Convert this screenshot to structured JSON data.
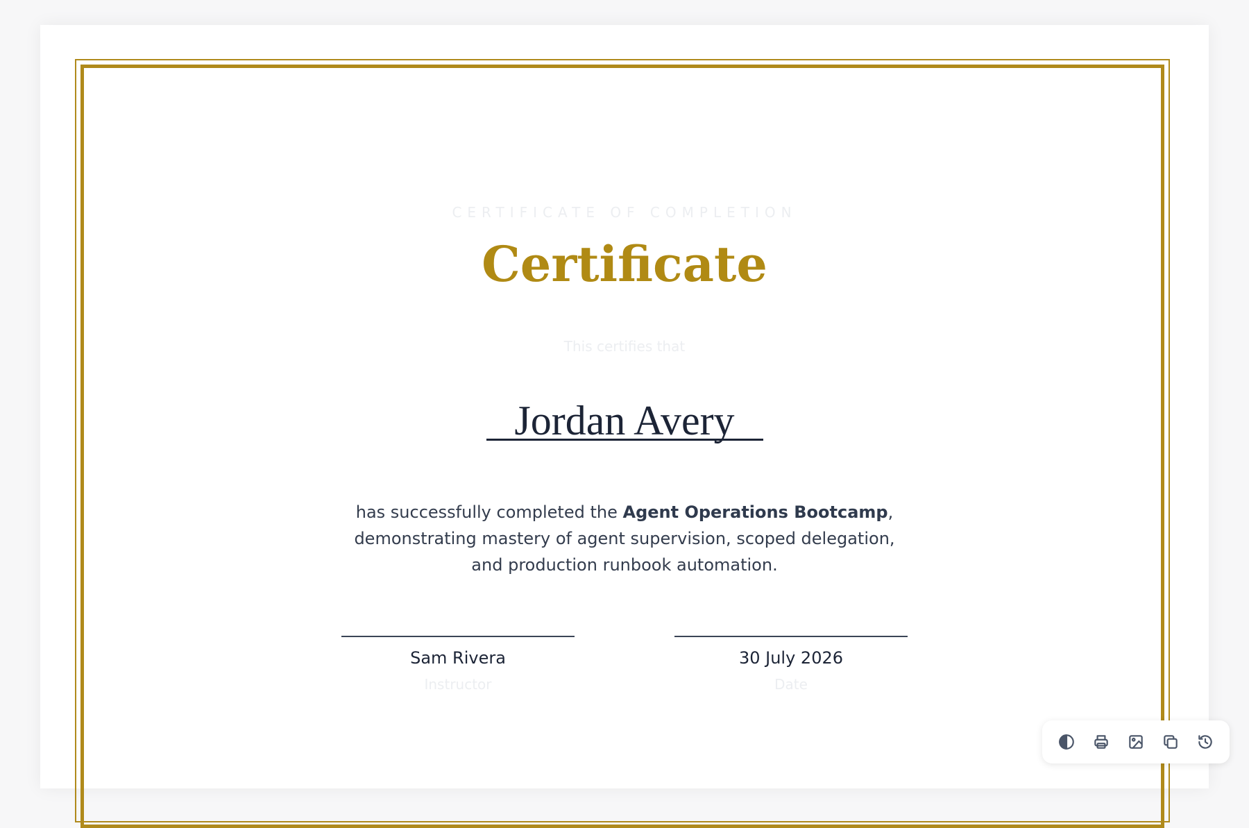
{
  "certificate": {
    "eyebrow": "CERTIFICATE OF COMPLETION",
    "title": "Certificate",
    "certifies_text": "This certifies that",
    "recipient_name": "Jordan Avery",
    "body_prefix": "has successfully completed the ",
    "course_name": "Agent Operations Bootcamp",
    "body_suffix": ", demonstrating mastery of agent supervision, scoped delegation, and production runbook automation.",
    "signatures": [
      {
        "value": "Sam Rivera",
        "label": "Instructor"
      },
      {
        "value": "30 July 2026",
        "label": "Date"
      }
    ]
  },
  "toolbar": {
    "buttons": [
      {
        "icon": "contrast-icon",
        "name": "toggle-theme-button"
      },
      {
        "icon": "print-icon",
        "name": "print-button"
      },
      {
        "icon": "image-icon",
        "name": "export-image-button"
      },
      {
        "icon": "copy-icon",
        "name": "copy-button"
      },
      {
        "icon": "history-icon",
        "name": "history-button"
      }
    ]
  },
  "colors": {
    "accent_gold": "#b08a14",
    "ink": "#1c2436"
  }
}
